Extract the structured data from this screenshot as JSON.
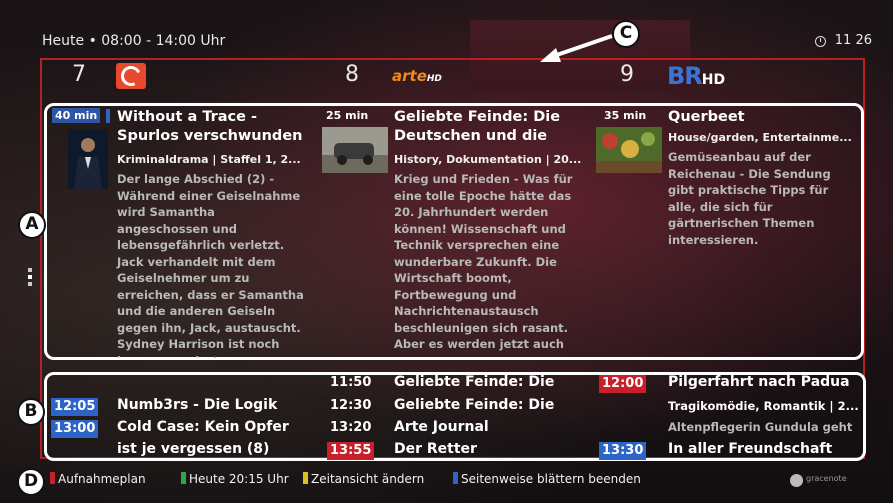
{
  "header": {
    "title": "Heute  •  08:00 - 14:00 Uhr",
    "time": "11 26"
  },
  "callouts": {
    "a": "A",
    "b": "B",
    "c": "C",
    "d": "D"
  },
  "channels": [
    {
      "number": "7",
      "logo": "kabel1-logo"
    },
    {
      "number": "8",
      "logo_text": "arte",
      "logo_suffix": "HD"
    },
    {
      "number": "9",
      "logo_text": "BR",
      "logo_suffix": "HD"
    }
  ],
  "programs": [
    {
      "duration": "40 min",
      "title": "Without a Trace - Spurlos verschwunden",
      "meta": "Kriminaldrama | Staffel 1, 2...",
      "desc": "Der lange Abschied (2) - Während einer Geiselnahme wird Samantha angeschossen und lebensgefährlich verletzt. Jack verhandelt mit dem Geiselnehmer um zu erreichen, dass er Samantha und die anderen Geiseln gegen ihn, Jack, austauscht. Sydney Harrison ist noch immer vermisst."
    },
    {
      "duration": "25 min",
      "title": "Geliebte Feinde: Die Deutschen und die",
      "meta": "History, Dokumentation | 20...",
      "desc": "Krieg und Frieden - Was für eine tolle Epoche hätte das 20. Jahrhundert werden können! Wissenschaft und Technik versprechen eine wunderbare Zukunft. Die Wirtschaft boomt, Fortbewegung und Nachrichtenaustausch beschleunigen sich rasant. Aber es werden jetzt auch"
    },
    {
      "duration": "35 min",
      "title": "Querbeet",
      "meta": "House/garden, Entertainme...",
      "desc": "Gemüseanbau auf der Reichenau - Die Sendung gibt praktische Tipps für alle, die sich für gärtnerischen Themen interessieren."
    }
  ],
  "schedule": {
    "col1": [
      {
        "time": "12:05",
        "title": "Numb3rs - Die Logik"
      },
      {
        "time": "13:00",
        "title": "Cold Case: Kein Opfer"
      },
      {
        "time": "",
        "title": "ist je vergessen (8)"
      }
    ],
    "col2": [
      {
        "time": "11:50",
        "title": "Geliebte Feinde: Die"
      },
      {
        "time": "12:30",
        "title": "Geliebte Feinde: Die"
      },
      {
        "time": "13:20",
        "title": "Arte Journal"
      },
      {
        "time": "13:55",
        "title": "Der Retter"
      }
    ],
    "col3": [
      {
        "time": "12:00",
        "title": "Pilgerfahrt nach Padua"
      },
      {
        "time": "",
        "title": "Tragikomödie, Romantik | 2..."
      },
      {
        "time": "",
        "title": "Altenpflegerin Gundula geht"
      },
      {
        "time": "13:30",
        "title": "In aller Freundschaft"
      }
    ]
  },
  "legend": {
    "red": "Aufnahmeplan",
    "green": "Heute 20:15 Uhr",
    "yellow": "Zeitansicht ändern",
    "blue": "Seitenweise blättern beenden"
  },
  "brand": "gracenote",
  "colors": {
    "red": "#c8202a",
    "green": "#2aa84a",
    "yellow": "#d8c21e",
    "blue": "#2c64c8",
    "frame_red": "#b61f24"
  }
}
